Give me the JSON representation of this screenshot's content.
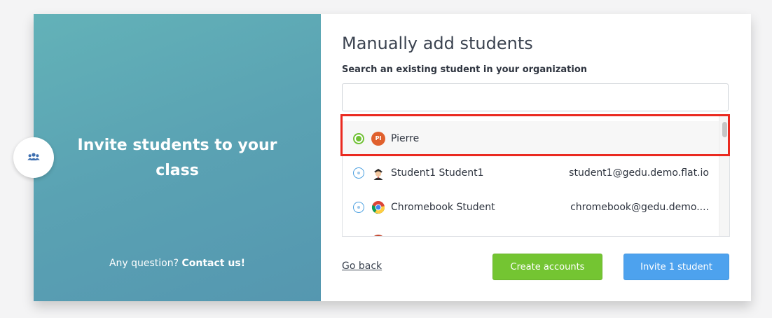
{
  "left_panel": {
    "title": "Invite students to your class",
    "question_prefix": "Any question?",
    "contact_label": "Contact us!"
  },
  "right_panel": {
    "heading": "Manually add students",
    "search_label": "Search an existing student in your organization",
    "search_value": "",
    "results": [
      {
        "name": "Pierre",
        "email": "",
        "avatar": "initials",
        "initials": "PI",
        "selected": true
      },
      {
        "name": "Student1 Student1",
        "email": "student1@gedu.demo.flat.io",
        "avatar": "student-avatar-icon",
        "selected": false
      },
      {
        "name": "Chromebook Student",
        "email": "chromebook@gedu.demo....",
        "avatar": "chrome-icon",
        "selected": false
      }
    ],
    "go_back_label": "Go back",
    "create_accounts_label": "Create accounts",
    "invite_label": "Invite 1 student"
  },
  "colors": {
    "accent_green": "#74c532",
    "accent_blue": "#4da2ee",
    "highlight_red": "#ea2a20",
    "panel_teal": "#5aa2b3"
  }
}
